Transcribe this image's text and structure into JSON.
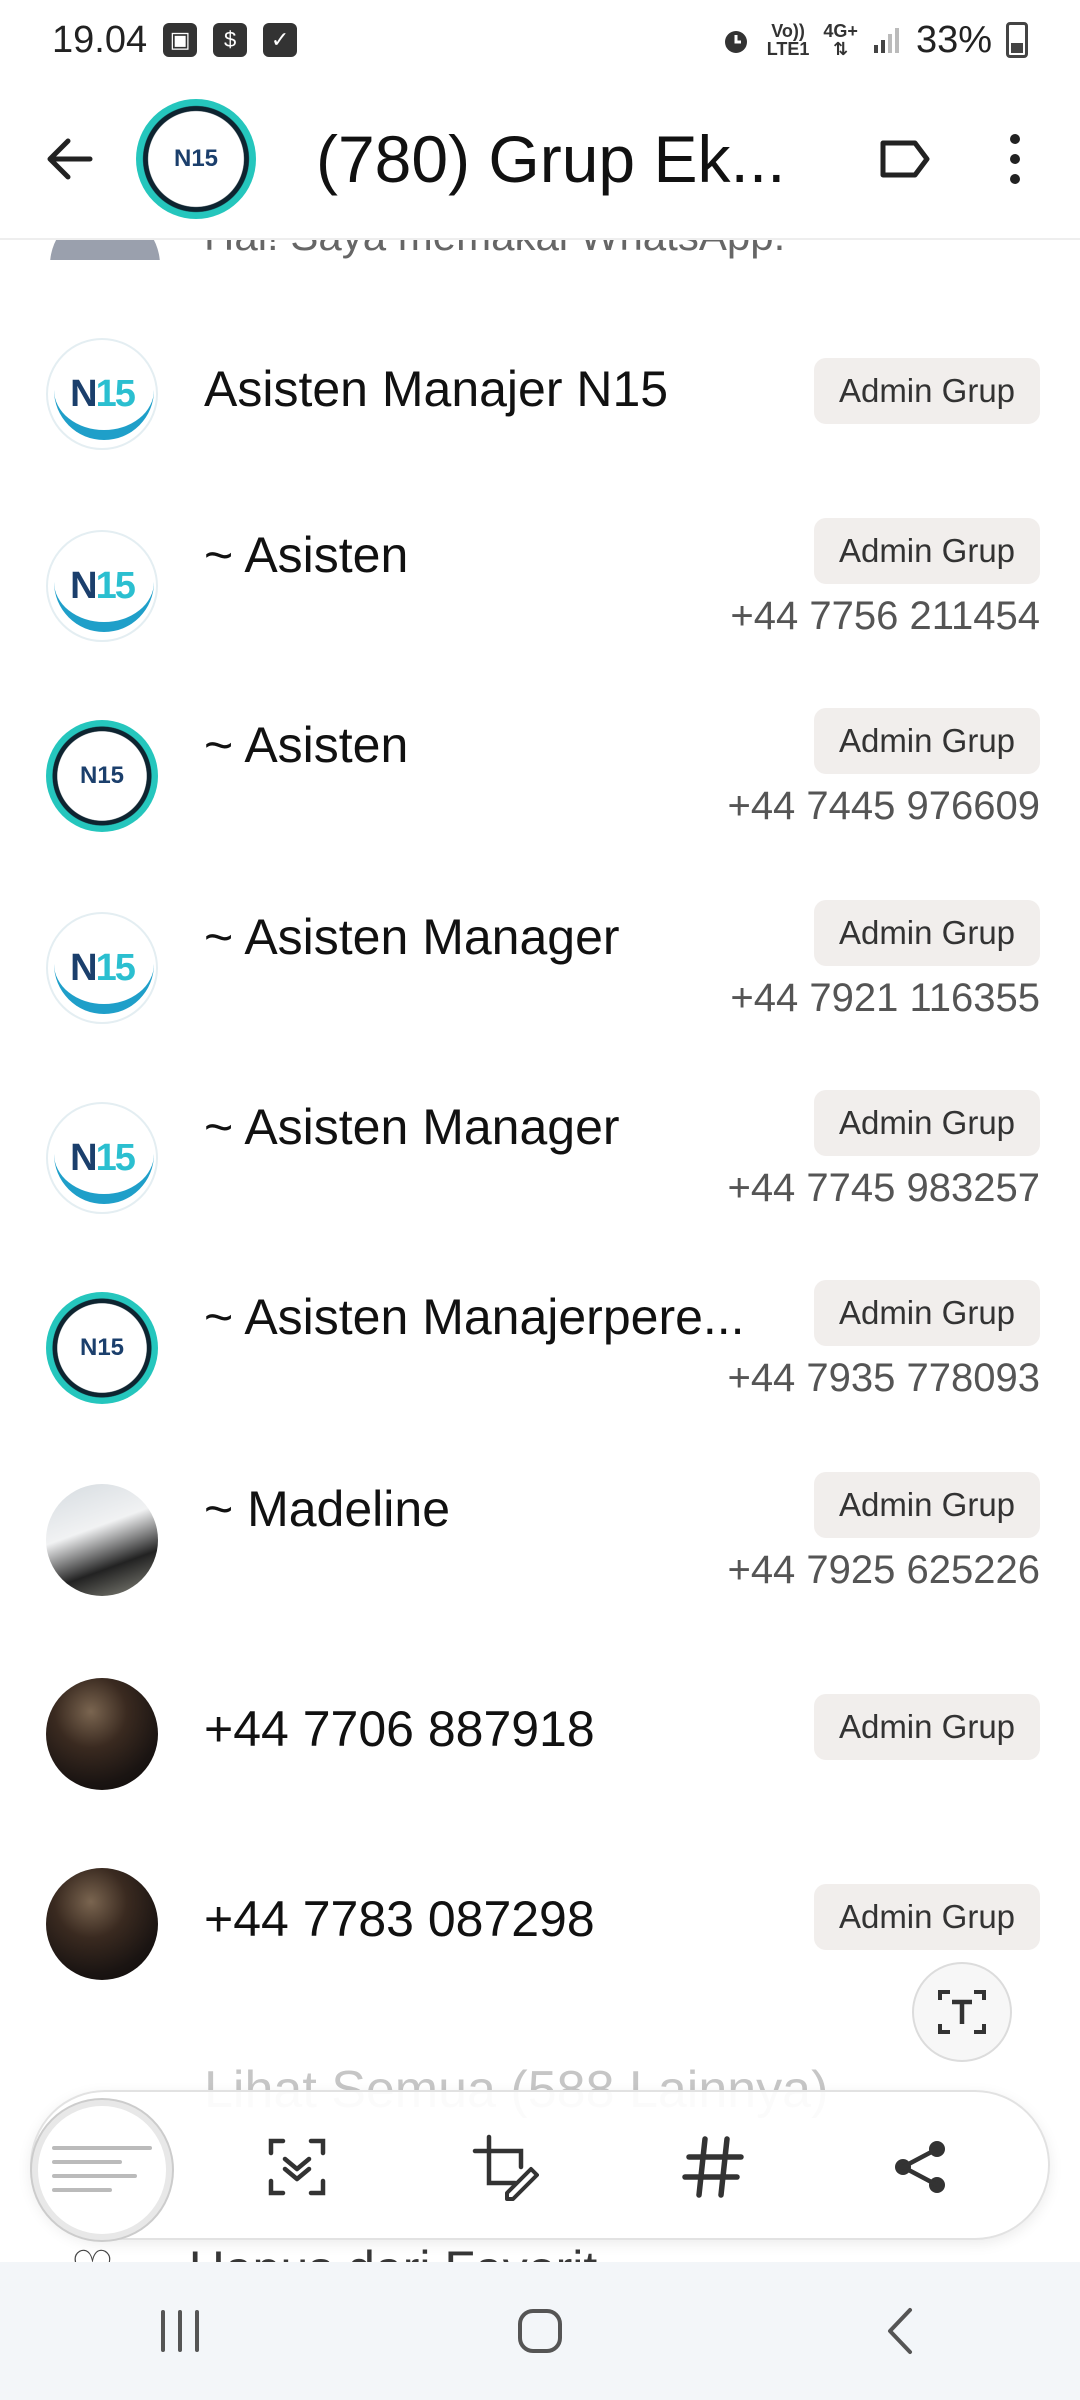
{
  "status_bar": {
    "time": "19.04",
    "network": "Vo))\nLTE1",
    "network_label_top": "Vo))",
    "network_label_bottom": "LTE1",
    "mobile_gen": "4G+",
    "battery": "33%"
  },
  "header": {
    "title": "(780)  Grup Ek...",
    "avatar_text": "N15"
  },
  "peek_row": {
    "status": "Hai! Saya memakai WhatsApp."
  },
  "members": [
    {
      "name": "Asisten Manajer N15",
      "badge": "Admin Grup",
      "phone": "",
      "avatar": "n15-hand"
    },
    {
      "name": "~ Asisten",
      "badge": "Admin Grup",
      "phone": "+44 7756 211454",
      "avatar": "n15-hand"
    },
    {
      "name": "~ Asisten",
      "badge": "Admin Grup",
      "phone": "+44 7445 976609",
      "avatar": "n15-ring"
    },
    {
      "name": "~ Asisten Manager",
      "badge": "Admin Grup",
      "phone": "+44 7921 116355",
      "avatar": "n15-hand"
    },
    {
      "name": "~ Asisten Manager",
      "badge": "Admin Grup",
      "phone": "+44 7745 983257",
      "avatar": "n15-hand"
    },
    {
      "name": "~ Asisten Manajerpere...",
      "badge": "Admin Grup",
      "phone": "+44 7935 778093",
      "avatar": "n15-ring"
    },
    {
      "name": "~ Madeline",
      "badge": "Admin Grup",
      "phone": "+44 7925 625226",
      "avatar": "photo-light"
    },
    {
      "name": "+44 7706 887918",
      "badge": "Admin Grup",
      "phone": "",
      "avatar": "photo-dark"
    },
    {
      "name": "+44 7783 087298",
      "badge": "Admin Grup",
      "phone": "",
      "avatar": "photo-dark"
    }
  ],
  "see_all": "Lihat Semua (588 Lainnya)",
  "below_toolbar_text": "Hapus dari Favorit",
  "toolbar": {
    "icons": [
      "scan-icon",
      "crop-edit-icon",
      "hashtag-icon",
      "share-icon"
    ]
  },
  "colors": {
    "badge_bg": "#f1eeec",
    "teal": "#25c6bd",
    "navy": "#1b3f6c"
  }
}
